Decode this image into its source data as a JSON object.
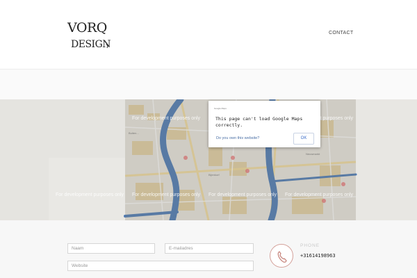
{
  "header": {
    "logo_line1": "VORQ",
    "logo_line2": "DESIGN",
    "nav_contact": "CONTACT"
  },
  "map": {
    "dev_notice": "For development purposes only",
    "dialog": {
      "brand": "Google Maps",
      "title": "This page can't load Google Maps correctly.",
      "question": "Do you own this website?",
      "ok_label": "OK"
    }
  },
  "form": {
    "name_placeholder": "Naam",
    "email_placeholder": "E-mailadres",
    "website_placeholder": "Website"
  },
  "contact": {
    "phone_label": "PHONE",
    "phone_number": "+31614198963"
  },
  "colors": {
    "accent": "#d4a19a",
    "link": "#3b6ec9",
    "water": "#4d7ab4",
    "map_tint": "#6a6a62"
  }
}
